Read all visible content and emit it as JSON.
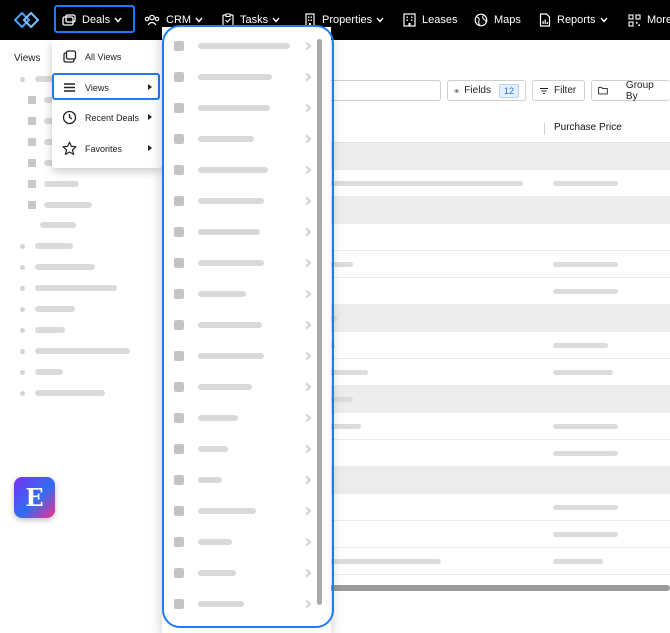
{
  "nav": {
    "deals_label": "Deals",
    "crm_label": "CRM",
    "tasks_label": "Tasks",
    "properties_label": "Properties",
    "leases_label": "Leases",
    "maps_label": "Maps",
    "reports_label": "Reports",
    "more_label": "More"
  },
  "sidebar": {
    "title": "Views"
  },
  "toolbar": {
    "fields_label": "Fields",
    "fields_count": "12",
    "filter_label": "Filter",
    "groupby_label": "Group By"
  },
  "grid": {
    "purchase_price_header": "Purchase Price"
  },
  "deals_menu": {
    "items": [
      {
        "label": "All Views",
        "icon": "stack-icon"
      },
      {
        "label": "Views",
        "icon": "list-icon"
      },
      {
        "label": "Recent Deals",
        "icon": "clock-icon"
      },
      {
        "label": "Favorites",
        "icon": "star-icon"
      }
    ]
  },
  "badge": {
    "letter": "E"
  },
  "colors": {
    "accent": "#1e7bf2",
    "nav_bg": "#000000"
  }
}
